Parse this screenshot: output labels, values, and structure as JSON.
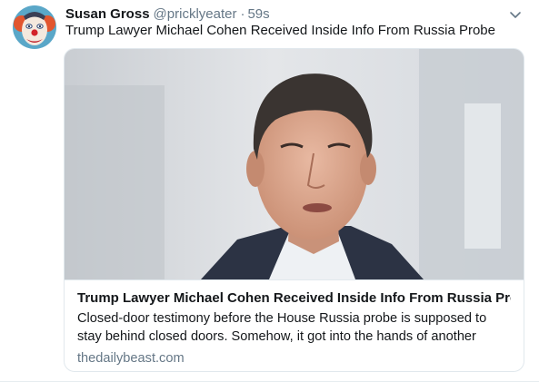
{
  "tweet": {
    "author": {
      "name": "Susan Gross",
      "handle": "@pricklyeater",
      "avatar_icon": "clown-avatar"
    },
    "separator": "·",
    "timestamp": "59s",
    "text": "Trump Lawyer Michael Cohen Received Inside Info From Russia Probe",
    "menu_icon": "chevron-down-icon"
  },
  "card": {
    "image_icon": "article-photo",
    "title": "Trump Lawyer Michael Cohen Received Inside Info From Russia Probe",
    "description": "Closed-door testimony before the House Russia probe is supposed to stay behind closed doors. Somehow, it got into the hands of another witness—...",
    "domain": "thedailybeast.com"
  },
  "colors": {
    "text_primary": "#14171a",
    "text_secondary": "#657786",
    "border": "#e1e8ed",
    "background": "#ffffff"
  }
}
